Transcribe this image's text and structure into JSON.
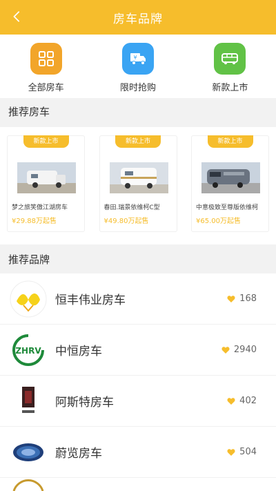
{
  "header": {
    "title": "房车品牌"
  },
  "categories": [
    {
      "label": "全部房车",
      "color": "#f2a52a",
      "icon": "grid-icon"
    },
    {
      "label": "限时抢购",
      "color": "#3aa4f3",
      "icon": "flash-sale-truck-icon"
    },
    {
      "label": "新款上市",
      "color": "#61c246",
      "icon": "bus-icon"
    }
  ],
  "sections": {
    "recommend_rv": "推荐房车",
    "recommend_brand": "推荐品牌"
  },
  "recommended_rvs": [
    {
      "badge": "新款上市",
      "name": "梦之旅笑傲江湖房车",
      "price": "¥29.88万起售"
    },
    {
      "badge": "新款上市",
      "name": "春田.瑞景依维柯C型",
      "price": "¥49.80万起售"
    },
    {
      "badge": "新款上市",
      "name": "中意极致至尊版依维柯",
      "price": "¥65.00万起售"
    }
  ],
  "brands": [
    {
      "name": "恒丰伟业房车",
      "likes": "168"
    },
    {
      "name": "中恒房车",
      "likes": "2940"
    },
    {
      "name": "阿斯特房车",
      "likes": "402"
    },
    {
      "name": "蔚览房车",
      "likes": "504"
    }
  ],
  "colors": {
    "accent": "#f6bd2c"
  }
}
